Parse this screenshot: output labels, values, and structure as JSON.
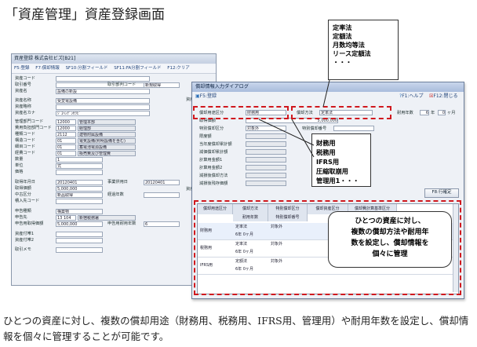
{
  "title": "「資産管理」資産登録画面",
  "caption": "ひとつの資産に対し、複数の償却用途（財務用、税務用、IFRS用、管理用）や耐用年数を設定し、償却情報を個々に管理することが可能です。",
  "main_window": {
    "title": "資産登録 株式会社ビズ[B21]",
    "toolbar": [
      "F5:登録",
      "F7:償却情報",
      "SF10:分割フィールド",
      "SF11:FA分割フィールド",
      "F12:クリア"
    ],
    "fields": [
      {
        "label": "資産コード",
        "value": ""
      },
      {
        "label": "取引番号",
        "value": "",
        "extra_label": "取引部判コード",
        "extra_value": "新規取得"
      },
      {
        "label": "資産名",
        "value": "設備の新設"
      },
      {
        "label": "資産名称",
        "value": "受変電設備"
      },
      {
        "label": "資産略称",
        "value": ""
      },
      {
        "label": "資産名カナ",
        "value": "ｼﾞﾕﾍﾝﾃﾞﾝｾﾂﾋﾞ"
      },
      {
        "label": "管理部門コード",
        "value": "12000",
        "name": "管理本部"
      },
      {
        "label": "費用負担部門コード",
        "value": "12000",
        "name": "経理部"
      },
      {
        "label": "種類コード",
        "value": "2112",
        "name": "建物附属設備"
      },
      {
        "label": "構造コード",
        "value": "01",
        "name": "電気設備(照明設備を含む)"
      },
      {
        "label": "細目コード",
        "value": "01",
        "name": "蓄電池電源設備"
      },
      {
        "label": "経費コード",
        "value": "01",
        "name": "販売費及び管理費"
      },
      {
        "label": "数量",
        "value": "1"
      },
      {
        "label": "単位",
        "value": "式"
      },
      {
        "label": "価格",
        "value": ""
      },
      {
        "label": "取得年月日",
        "value": "20120401",
        "extra_label": "事業供用日",
        "extra_value": "20120401"
      },
      {
        "label": "取得価額",
        "value": "5,000,000"
      },
      {
        "label": "中古区分",
        "value": "新品取得",
        "extra_label": "経過年数",
        "extra_value": ""
      },
      {
        "label": "積入先コード",
        "value": ""
      },
      {
        "label": "申告種類",
        "value": "構築物"
      },
      {
        "label": "申告先",
        "value": "13 104",
        "name": "新宿税務署"
      },
      {
        "label": "申告用取得価額",
        "value": "5,000,000",
        "extra_label": "申告用耐用年数",
        "extra_value": "6"
      },
      {
        "label": "資産付帯1",
        "value": ""
      },
      {
        "label": "資産付帯2",
        "value": ""
      },
      {
        "label": "取引メモ",
        "value": ""
      }
    ],
    "right_labels": [
      "資産",
      "資産計上年"
    ]
  },
  "dialog": {
    "title": "償却情報入力ダイアログ",
    "register_button": "F5:登録",
    "help_button": "F1:ヘルプ",
    "close_button": "F12:閉じる",
    "fields": [
      {
        "label": "償却用途区分",
        "value": "財務用"
      },
      {
        "label": "取得価額",
        "value": "5,000,000"
      },
      {
        "label": "特別償却区分",
        "value": "対象外"
      },
      {
        "label": "限度額",
        "value": ""
      },
      {
        "label": "当年度償却累計額",
        "value": ""
      },
      {
        "label": "減価償却累計額",
        "value": ""
      },
      {
        "label": "計算用金額1",
        "value": ""
      },
      {
        "label": "計算用金額2",
        "value": ""
      },
      {
        "label": "減損後償却方法",
        "value": ""
      },
      {
        "label": "減損後残存価額",
        "value": ""
      }
    ],
    "method_label": "償却方法",
    "method_value": "定率法",
    "life_label": "耐用年数",
    "life_years": "6",
    "life_year_unit": "年",
    "life_months": "0",
    "life_month_unit": "ヶ月",
    "special_number_label": "特別償却番号",
    "confirm_button": "F8:行確定",
    "grid_headers": [
      "償却用途区分",
      "償却方法",
      "特別償却区分",
      "償却資産区分",
      "償却費計算基準区分"
    ],
    "grid_subheaders": [
      "耐用年数",
      "特別償却番号"
    ],
    "grid_rows": [
      {
        "use": "財務用",
        "method": "定率法",
        "life": "6年 0ヶ月",
        "special": "対象外"
      },
      {
        "use": "税務用",
        "method": "定率法",
        "life": "6年 0ヶ月",
        "special": "対象外"
      },
      {
        "use": "IFRS用",
        "method": "定額法",
        "life": "6年 0ヶ月",
        "special": "対象外"
      }
    ]
  },
  "annotations": {
    "methods_box": [
      "定率法",
      "定額法",
      "月数均等法",
      "リース定額法",
      "・・・"
    ],
    "uses_box": [
      "財務用",
      "税務用",
      "IFRS用",
      "圧縮取崩用",
      "管理用1・・・"
    ],
    "bubble": [
      "ひとつの資産に対し、",
      "複数の償却方法や耐用年",
      "数を設定し、償却情報を",
      "個々に管理"
    ]
  },
  "colors": {
    "annotation_red": "#d0181e",
    "titlebar": "#c9d6ec"
  }
}
